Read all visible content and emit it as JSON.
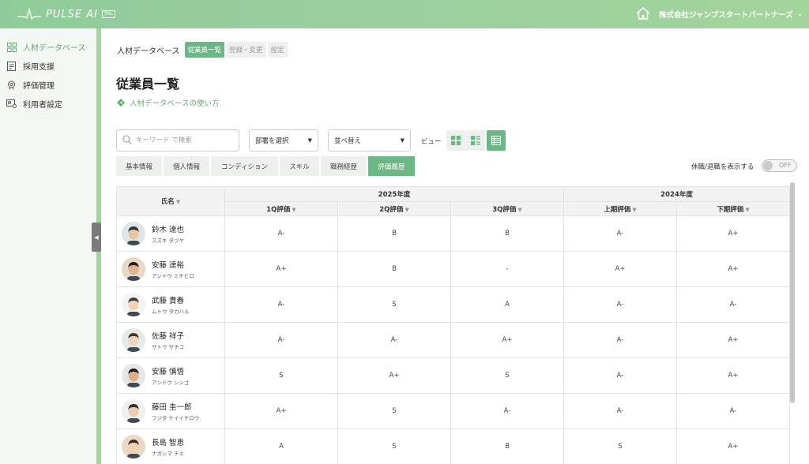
{
  "header": {
    "logo_text": "PULSE AI",
    "logo_badge": "TAL",
    "company": "株式会社ジャンプスタートパートナーズ"
  },
  "sidebar": {
    "items": [
      {
        "label": "人材データベース",
        "icon": "database-icon",
        "active": true
      },
      {
        "label": "採用支援",
        "icon": "document-icon"
      },
      {
        "label": "評価管理",
        "icon": "award-icon"
      },
      {
        "label": "利用者設定",
        "icon": "user-settings-icon"
      }
    ]
  },
  "breadcrumb": {
    "root": "人材データベース",
    "tabs": [
      "従業員一覧",
      "登録・変更",
      "設定"
    ]
  },
  "page": {
    "title": "従業員一覧",
    "help_link": "人材データベースの使い方"
  },
  "filters": {
    "search_placeholder": "キーワード で検索",
    "department": "部署を選択",
    "sort": "並べ替え",
    "view_label": "ビュー"
  },
  "tabs": [
    "基本情報",
    "個人情報",
    "コンディション",
    "スキル",
    "職務経歴",
    "評価履歴"
  ],
  "active_tab": "評価履歴",
  "toggle": {
    "label": "休職/退職を表示する",
    "state": "OFF"
  },
  "table": {
    "name_header": "氏名",
    "groups": [
      "2025年度",
      "2024年度"
    ],
    "columns": [
      "1Q評価",
      "2Q評価",
      "3Q評価",
      "上期評価",
      "下期評価"
    ],
    "rows": [
      {
        "name": "鈴木 達也",
        "kana": "スズキ タツヤ",
        "scores": [
          "A-",
          "B",
          "B",
          "A-",
          "A+"
        ]
      },
      {
        "name": "安藤 達裕",
        "kana": "アンドウ ミチヒロ",
        "scores": [
          "A+",
          "B",
          "-",
          "A+",
          "A+"
        ]
      },
      {
        "name": "武藤 貴春",
        "kana": "ムトウ タカハル",
        "scores": [
          "A-",
          "S",
          "A",
          "A-",
          "A-"
        ]
      },
      {
        "name": "佐藤 祥子",
        "kana": "サトウ サチコ",
        "scores": [
          "A-",
          "A-",
          "A+",
          "A-",
          "A+"
        ]
      },
      {
        "name": "安藤 慎悟",
        "kana": "アンドウ シンゴ",
        "scores": [
          "S",
          "A+",
          "S",
          "A-",
          "A+"
        ]
      },
      {
        "name": "藤田 圭一郎",
        "kana": "フジタ ケイイチロウ",
        "scores": [
          "A+",
          "S",
          "A-",
          "A-",
          "A-"
        ]
      },
      {
        "name": "長島 智恵",
        "kana": "ナガシマ チエ",
        "scores": [
          "A",
          "S",
          "B",
          "S",
          "A+"
        ]
      }
    ]
  },
  "colors": {
    "accent": "#6db685",
    "header_gradient_start": "#8fcb9a",
    "sidebar_strip": "#a4d4a4"
  }
}
